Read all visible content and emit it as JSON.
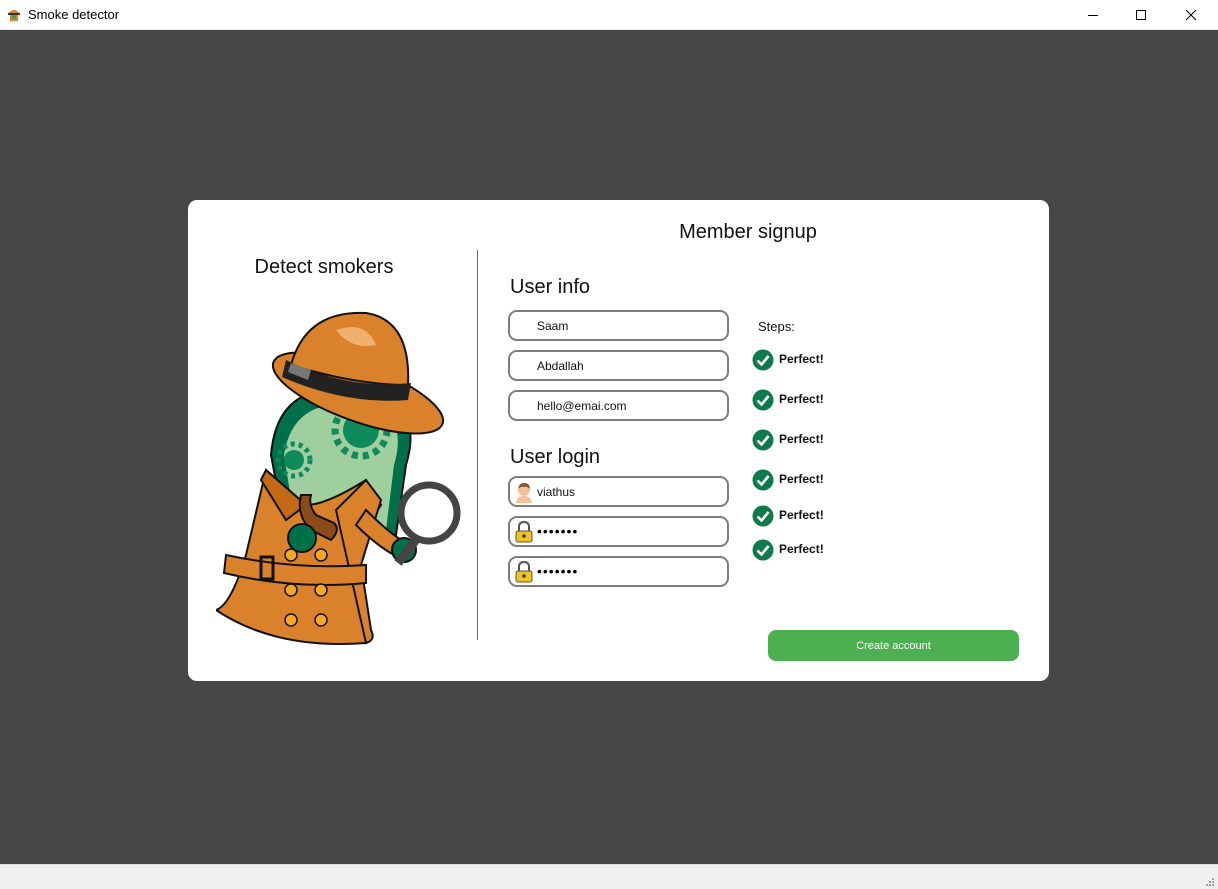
{
  "window": {
    "title": "Smoke detector"
  },
  "left": {
    "heading": "Detect smokers"
  },
  "form": {
    "heading": "Member signup",
    "user_info": {
      "heading": "User info",
      "first_name": "Saam",
      "last_name": "Abdallah",
      "email": "hello@emai.com"
    },
    "user_login": {
      "heading": "User login",
      "username": "viathus",
      "password": "•••••••",
      "confirm_password": "•••••••"
    },
    "steps": {
      "label": "Steps:",
      "items": [
        "Perfect!",
        "Perfect!",
        "Perfect!",
        "Perfect!",
        "Perfect!",
        "Perfect!"
      ]
    },
    "create_button": "Create account"
  },
  "colors": {
    "accent": "#4caf50",
    "check": "#0e7a4c",
    "background": "#474747"
  }
}
